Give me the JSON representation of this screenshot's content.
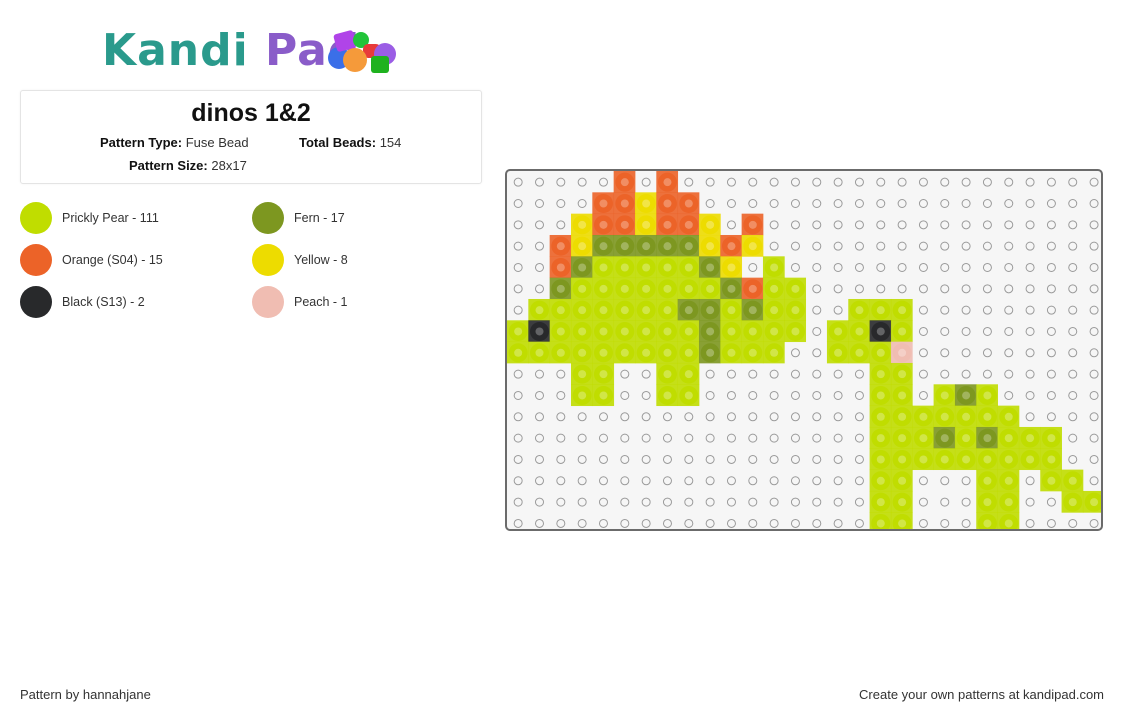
{
  "logo": {
    "part1": "Kandi",
    "part2": " Pad",
    "bead_colors": [
      "#3b6fe8",
      "#b044e8",
      "#22c43a",
      "#e83a3a",
      "#f59a3a",
      "#1fb21f",
      "#9b5de5"
    ]
  },
  "pattern": {
    "title": "dinos 1&2",
    "type_label": "Pattern Type:",
    "type_value": "Fuse Bead",
    "beads_label": "Total Beads:",
    "beads_value": "154",
    "size_label": "Pattern Size:",
    "size_value": "28x17"
  },
  "legend": [
    {
      "key": "P",
      "label": "Prickly Pear - 111",
      "color": "#c0dd00"
    },
    {
      "key": "F",
      "label": "Fern - 17",
      "color": "#7d9720"
    },
    {
      "key": "O",
      "label": "Orange (S04) - 15",
      "color": "#ec6328"
    },
    {
      "key": "Y",
      "label": "Yellow - 8",
      "color": "#eddc00"
    },
    {
      "key": "B",
      "label": "Black (S13) - 2",
      "color": "#28292b"
    },
    {
      "key": "K",
      "label": "Peach - 1",
      "color": "#f0bdb2"
    }
  ],
  "grid": {
    "columns": 28,
    "rows": 17,
    "peg_color": "#9a9a9a",
    "cells": [
      ".....O.O....................",
      "....OOYOO...................",
      "...YOOYOOY.O................",
      "..OYFFFFFYOY................",
      "..OFPPPPPFY.P...............",
      "..FPPPPPPPFOPP..............",
      ".PPPPPPPFFPFPP..PPP.........",
      "PBPPPPPPPFPPPP.PPBP.........",
      "PPPPPPPPPFPPP..PPPK.........",
      "...PP..PP........PP.........",
      "...PP..PP........PP.PFP.....",
      ".................PPPPPPP....",
      ".................PPPFPFPPP..",
      ".................PPPPPPPPP..",
      ".................PP...PP.PP.",
      ".................PP...PP..PP",
      ".................PP...PP...."
    ]
  },
  "footer": {
    "credit": "Pattern by hannahjane",
    "promo": "Create your own patterns at kandipad.com"
  }
}
